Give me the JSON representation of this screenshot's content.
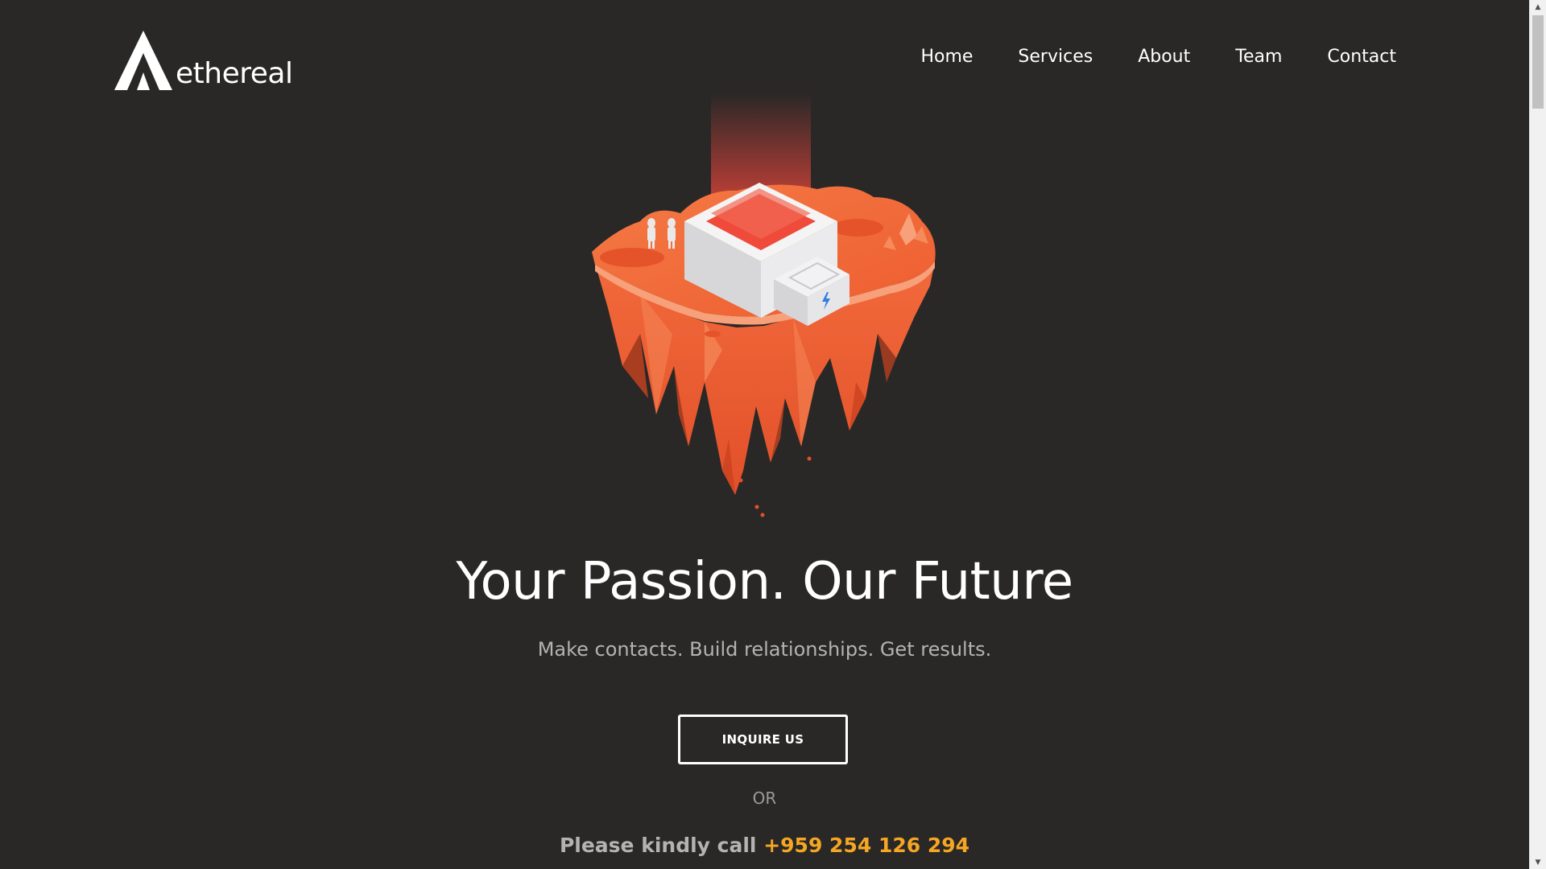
{
  "brand": {
    "name": "ethereal",
    "logo_icon": "ethereal-mountain-logo"
  },
  "nav": {
    "items": [
      {
        "label": "Home"
      },
      {
        "label": "Services"
      },
      {
        "label": "About"
      },
      {
        "label": "Team"
      },
      {
        "label": "Contact"
      }
    ]
  },
  "hero": {
    "illustration": "floating-island-illustration",
    "title": "Your Passion. Our Future",
    "subtitle": "Make contacts. Build relationships. Get results.",
    "cta_label": "INQUIRE US",
    "or_text": "OR",
    "call_prefix": "Please kindly call",
    "phone": "+959 254 126 294"
  },
  "colors": {
    "background": "#292827",
    "accent_phone": "#f5a623",
    "island_orange": "#f0572c",
    "text_white": "#ffffff",
    "text_muted": "#b5b3b1"
  },
  "scrollbar": {
    "up_icon": "scroll-up-arrow-icon",
    "down_icon": "scroll-down-arrow-icon"
  }
}
